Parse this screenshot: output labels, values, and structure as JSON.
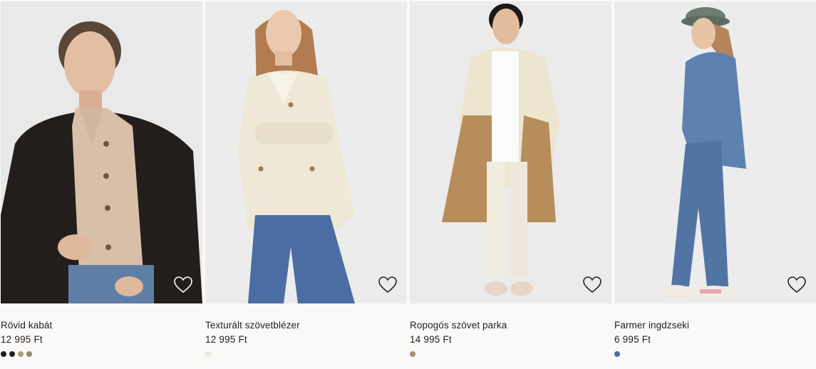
{
  "products": [
    {
      "name": "Rövid kabát",
      "price": "12 995 Ft",
      "image_icon": "model-photo-short-jacket",
      "swatches": [
        "#1f1b1a",
        "#262421",
        "#b39a82",
        "#9b8570"
      ]
    },
    {
      "name": "Texturált szövetblézer",
      "price": "12 995 Ft",
      "image_icon": "model-photo-textured-blazer",
      "swatches": [
        "#efece0"
      ]
    },
    {
      "name": "Ropogós szövet parka",
      "price": "14 995 Ft",
      "image_icon": "model-photo-parka",
      "swatches": [
        "#a8906d"
      ]
    },
    {
      "name": "Farmer ingdzseki",
      "price": "6 995 Ft",
      "image_icon": "model-photo-denim-shirt-jacket",
      "swatches": [
        "#4a6f9a"
      ]
    }
  ],
  "favorite_icon": "heart-outline-icon"
}
